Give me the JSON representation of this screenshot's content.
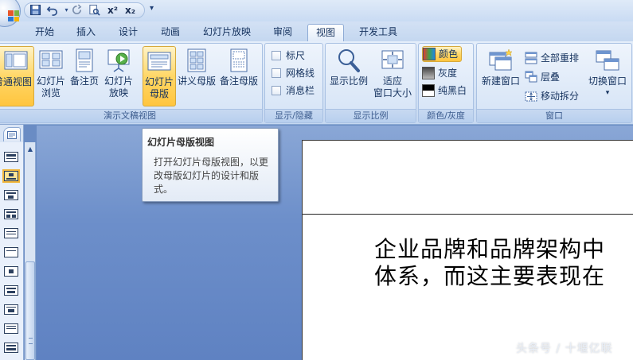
{
  "quick_access": {
    "save_icon": "save-icon",
    "undo_icon": "undo-icon",
    "redo_icon": "redo-icon",
    "print_preview_icon": "print-preview-icon",
    "superscript_label": "x²",
    "subscript_label": "x₂",
    "customize_label": "▾"
  },
  "tabs": [
    {
      "label": "开始"
    },
    {
      "label": "插入"
    },
    {
      "label": "设计"
    },
    {
      "label": "动画"
    },
    {
      "label": "幻灯片放映"
    },
    {
      "label": "审阅"
    },
    {
      "label": "视图",
      "active": true
    },
    {
      "label": "开发工具"
    }
  ],
  "ribbon": {
    "presentation_views": {
      "label": "演示文稿视图",
      "normal": "普通视图",
      "sorter_line1": "幻灯片",
      "sorter_line2": "浏览",
      "notes": "备注页",
      "show_line1": "幻灯片",
      "show_line2": "放映",
      "master_line1": "幻灯片",
      "master_line2": "母版",
      "handout_master": "讲义母版",
      "notes_master": "备注母版"
    },
    "show_hide": {
      "label": "显示/隐藏",
      "ruler": "标尺",
      "gridlines": "网格线",
      "message_bar": "消息栏"
    },
    "zoom": {
      "label": "显示比例",
      "zoom": "显示比例",
      "fit_line1": "适应",
      "fit_line2": "窗口大小"
    },
    "color": {
      "label": "颜色/灰度",
      "color": "颜色",
      "grayscale": "灰度",
      "pure_bw": "纯黑白"
    },
    "window": {
      "label": "窗口",
      "new_window": "新建窗口",
      "arrange_all": "全部重排",
      "cascade": "层叠",
      "move_split": "移动拆分",
      "switch_windows": "切换窗口",
      "switch_arrow": "▾"
    }
  },
  "tooltip": {
    "title": "幻灯片母版视图",
    "body": "打开幻灯片母版视图，以更改母版幻灯片的设计和版式。"
  },
  "slide": {
    "line1": "企业品牌和品牌架构中",
    "line2": "体系，而这主要表现在"
  },
  "watermark": "头条号 / 十堰亿联",
  "colors": {
    "ribbon_bg": "#d5e3f5",
    "active_button": "#ffd767",
    "workspace_bg": "#6d8fca",
    "tab_text": "#15325e"
  }
}
